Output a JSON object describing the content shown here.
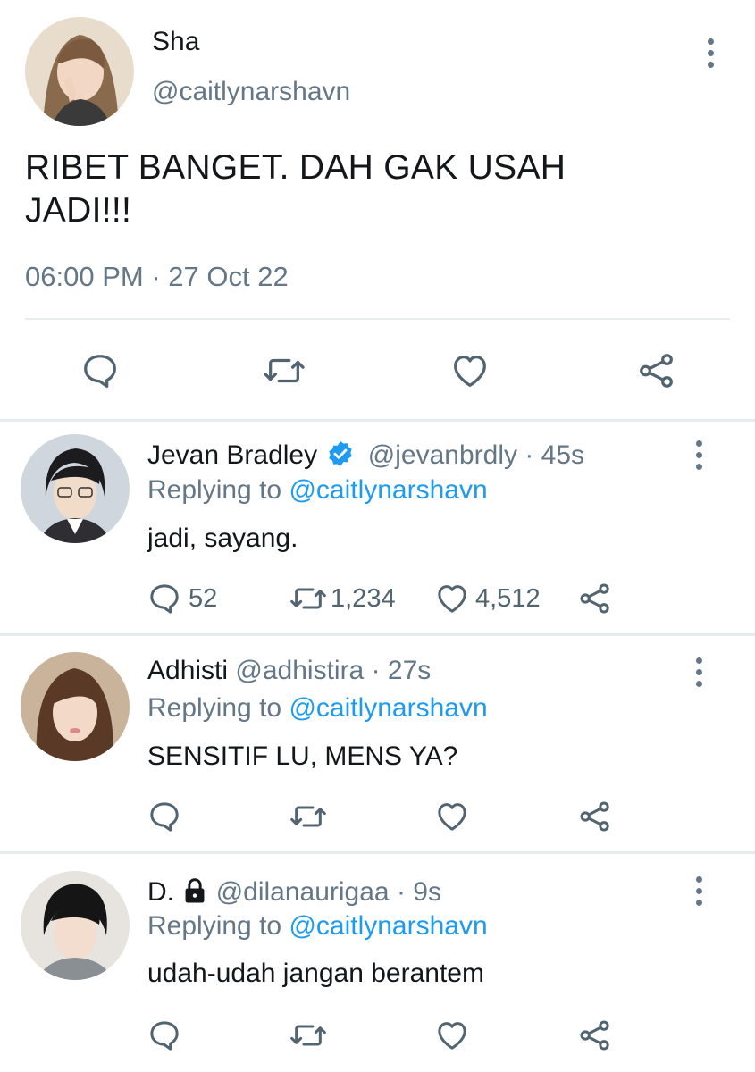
{
  "tweet": {
    "name": "Sha",
    "handle": "@caitlynarshavn",
    "text_line1": "RIBET BANGET. DAH GAK USAH",
    "text_line2": "JADI!!!",
    "time": "06:00 PM",
    "separator": "·",
    "date": "27 Oct 22"
  },
  "replies": [
    {
      "name": "Jevan Bradley",
      "verified": true,
      "handle": "@jevanbrdly",
      "age": "· 45s",
      "replying_prefix": "Replying to",
      "replying_handle": "@caitlynarshavn",
      "text": "jadi, sayang.",
      "reply_count": "52",
      "retweet_count": "1,234",
      "like_count": "4,512"
    },
    {
      "name": "Adhisti",
      "handle": "@adhistira",
      "age": "· 27s",
      "replying_prefix": "Replying to",
      "replying_handle": "@caitlynarshavn",
      "text": "SENSITIF LU, MENS YA?"
    },
    {
      "name": "D.",
      "locked": true,
      "handle": "@dilanaurigaa",
      "age": "· 9s",
      "replying_prefix": "Replying to",
      "replying_handle": "@caitlynarshavn",
      "text": "udah-udah jangan berantem"
    }
  ],
  "icons": {
    "reply": "speech-bubble-icon",
    "retweet": "retweet-icon",
    "like": "heart-icon",
    "share": "share-icon",
    "more": "more-vertical-icon",
    "verified": "verified-badge-icon",
    "lock": "lock-icon"
  },
  "colors": {
    "text": "#14171a",
    "muted": "#657786",
    "link": "#1d9bf0",
    "divider": "#e6ecf0"
  }
}
